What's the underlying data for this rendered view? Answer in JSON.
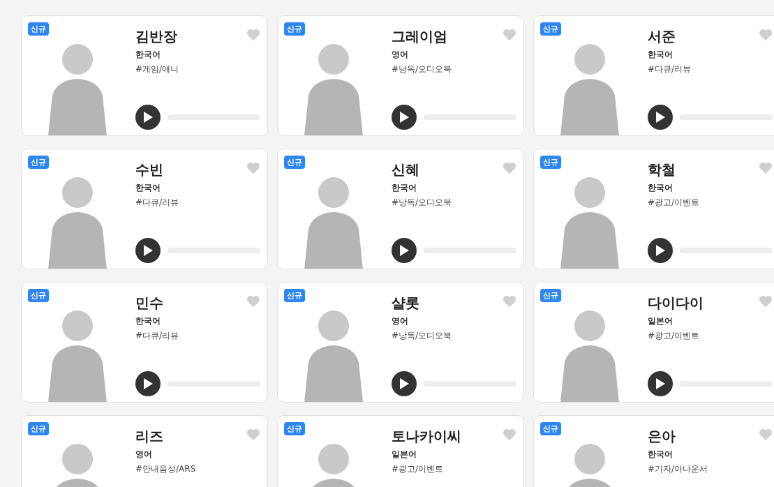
{
  "voices": [
    {
      "badge": "신규",
      "name": "김반장",
      "language": "한국어",
      "tag": "#게임/애니",
      "liked": false
    },
    {
      "badge": "신규",
      "name": "그레이엄",
      "language": "영어",
      "tag": "#낭독/오디오북",
      "liked": false
    },
    {
      "badge": "신규",
      "name": "서준",
      "language": "한국어",
      "tag": "#다큐/리뷰",
      "liked": false
    },
    {
      "badge": "신규",
      "name": "수빈",
      "language": "한국어",
      "tag": "#다큐/리뷰",
      "liked": false
    },
    {
      "badge": "신규",
      "name": "신혜",
      "language": "한국어",
      "tag": "#낭독/오디오북",
      "liked": false
    },
    {
      "badge": "신규",
      "name": "학철",
      "language": "한국어",
      "tag": "#광고/이벤트",
      "liked": false
    },
    {
      "badge": "신규",
      "name": "민수",
      "language": "한국어",
      "tag": "#다큐/리뷰",
      "liked": false
    },
    {
      "badge": "신규",
      "name": "샬롯",
      "language": "영어",
      "tag": "#낭독/오디오북",
      "liked": false
    },
    {
      "badge": "신규",
      "name": "다이다이",
      "language": "일본어",
      "tag": "#광고/이벤트",
      "liked": false
    },
    {
      "badge": "신규",
      "name": "리즈",
      "language": "영어",
      "tag": "#안내음성/ARS",
      "liked": false
    },
    {
      "badge": "신규",
      "name": "토나카이씨",
      "language": "일본어",
      "tag": "#광고/이벤트",
      "liked": false
    },
    {
      "badge": "신규",
      "name": "은아",
      "language": "한국어",
      "tag": "#기자/아나운서",
      "liked": false
    }
  ]
}
